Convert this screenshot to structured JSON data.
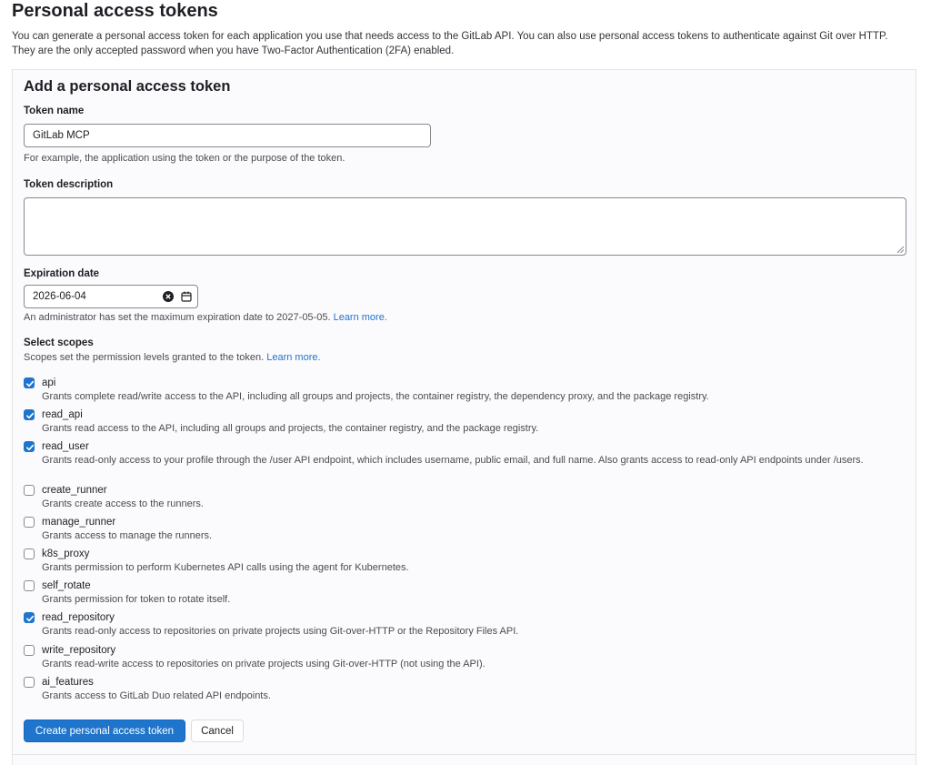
{
  "page": {
    "title": "Personal access tokens",
    "intro_line1": "You can generate a personal access token for each application you use that needs access to the GitLab API. You can also use personal access tokens to authenticate against Git over HTTP.",
    "intro_line2": "They are the only accepted password when you have Two-Factor Authentication (2FA) enabled."
  },
  "form": {
    "title": "Add a personal access token",
    "token_name_label": "Token name",
    "token_name_value": "GitLab MCP",
    "token_name_help": "For example, the application using the token or the purpose of the token.",
    "token_description_label": "Token description",
    "token_description_value": "",
    "expiration_label": "Expiration date",
    "expiration_value": "2026-06-04",
    "expiration_help": "An administrator has set the maximum expiration date to 2027-05-05.",
    "expiration_learn_more": "Learn more.",
    "scopes_label": "Select scopes",
    "scopes_help": "Scopes set the permission levels granted to the token.",
    "scopes_learn_more": "Learn more.",
    "scopes": [
      {
        "name": "api",
        "checked": true,
        "description": "Grants complete read/write access to the API, including all groups and projects, the container registry, the dependency proxy, and the package registry."
      },
      {
        "name": "read_api",
        "checked": true,
        "description": "Grants read access to the API, including all groups and projects, the container registry, and the package registry."
      },
      {
        "name": "read_user",
        "checked": true,
        "description": "Grants read-only access to your profile through the /user API endpoint, which includes username, public email, and full name. Also grants access to read-only API endpoints under /users."
      },
      {
        "name": "create_runner",
        "checked": false,
        "description": "Grants create access to the runners."
      },
      {
        "name": "manage_runner",
        "checked": false,
        "description": "Grants access to manage the runners."
      },
      {
        "name": "k8s_proxy",
        "checked": false,
        "description": "Grants permission to perform Kubernetes API calls using the agent for Kubernetes."
      },
      {
        "name": "self_rotate",
        "checked": false,
        "description": "Grants permission for token to rotate itself."
      },
      {
        "name": "read_repository",
        "checked": true,
        "description": "Grants read-only access to repositories on private projects using Git-over-HTTP or the Repository Files API."
      },
      {
        "name": "write_repository",
        "checked": false,
        "description": "Grants read-write access to repositories on private projects using Git-over-HTTP (not using the API)."
      },
      {
        "name": "ai_features",
        "checked": false,
        "description": "Grants access to GitLab Duo related API endpoints."
      }
    ],
    "create_button": "Create personal access token",
    "cancel_button": "Cancel"
  },
  "colors": {
    "primary": "#1f75cb",
    "link": "#1f75cb",
    "panel_bg": "#fbfafd"
  },
  "icons": {
    "clear": "clear-icon",
    "calendar": "calendar-icon",
    "check": "check-icon"
  }
}
